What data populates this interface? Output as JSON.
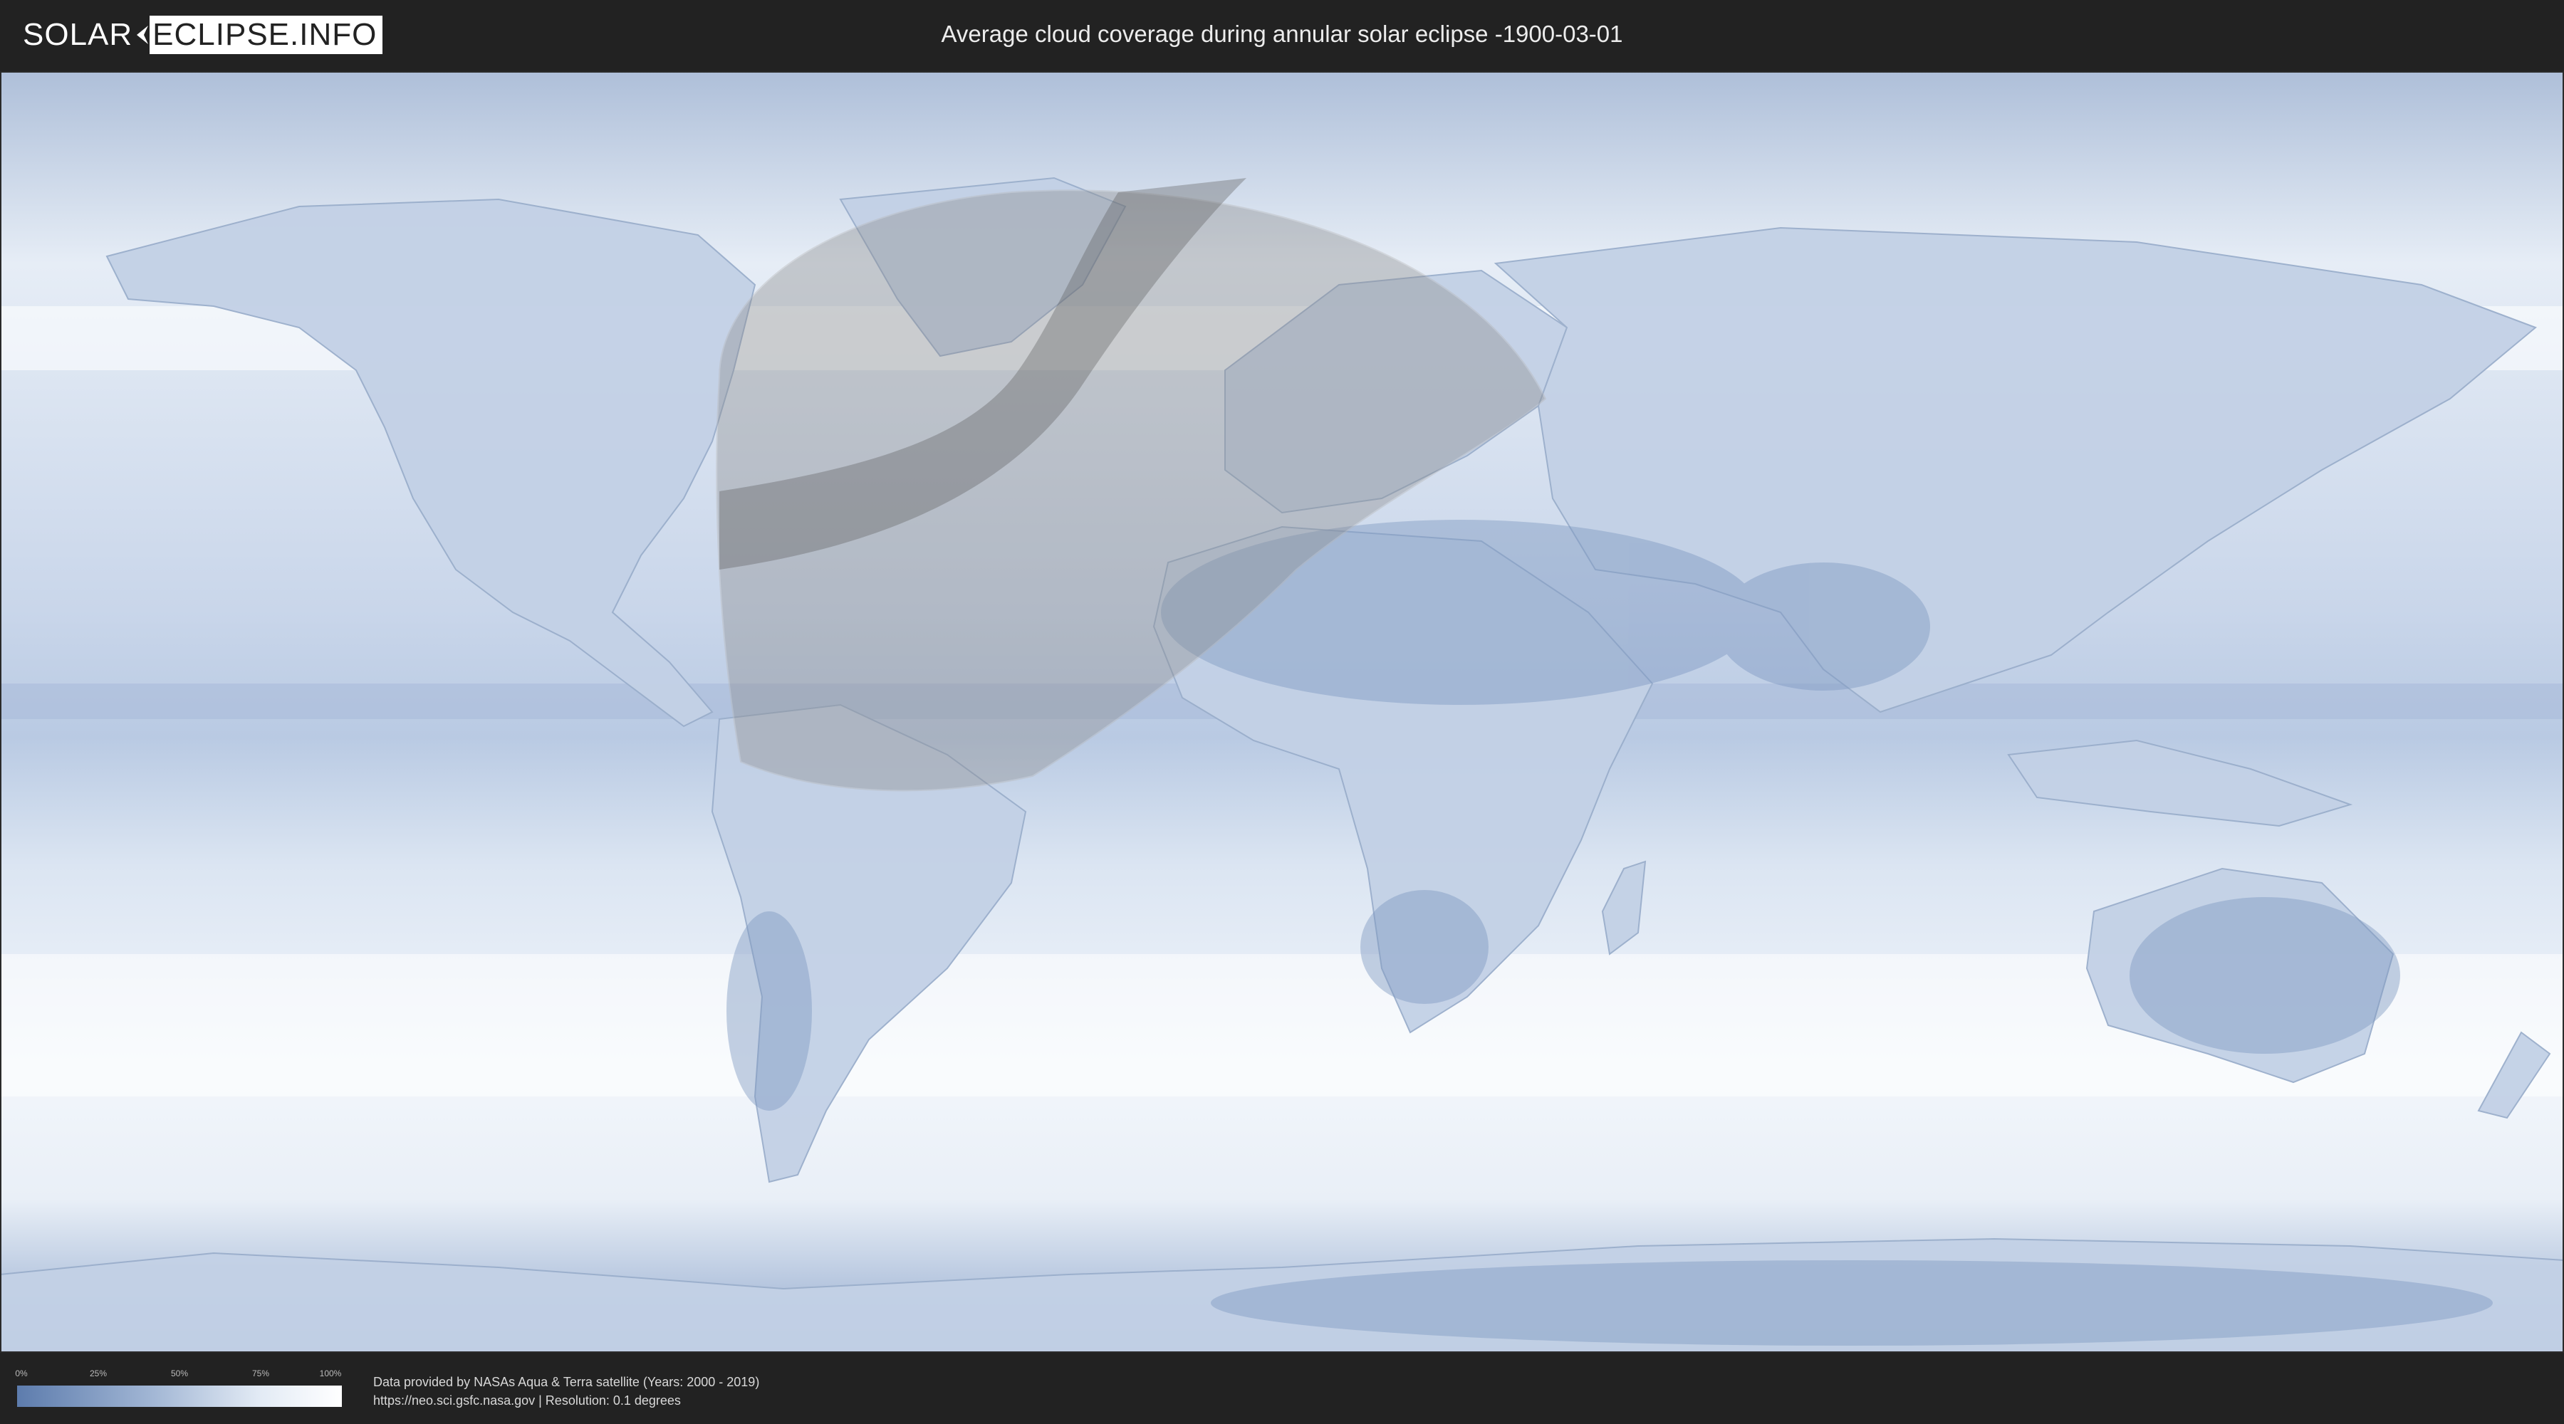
{
  "header": {
    "logo_left": "SOLAR",
    "logo_right": "ECLIPSE.INFO",
    "title": "Average cloud coverage during annular solar eclipse -1900-03-01"
  },
  "map": {
    "ocean_color": "#dde7f3",
    "land_color": "#c6d4e8",
    "cloud_low_color": "#5d7cad",
    "cloud_high_color": "#ffffff",
    "eclipse_region_color": "#8c8c8c",
    "eclipse_path_color": "#5a5a5a"
  },
  "legend": {
    "ticks": [
      "0%",
      "25%",
      "50%",
      "75%",
      "100%"
    ]
  },
  "credits": {
    "line1": "Data provided by NASAs Aqua & Terra satellite (Years: 2000 - 2019)",
    "line2": "https://neo.sci.gsfc.nasa.gov | Resolution: 0.1 degrees"
  }
}
